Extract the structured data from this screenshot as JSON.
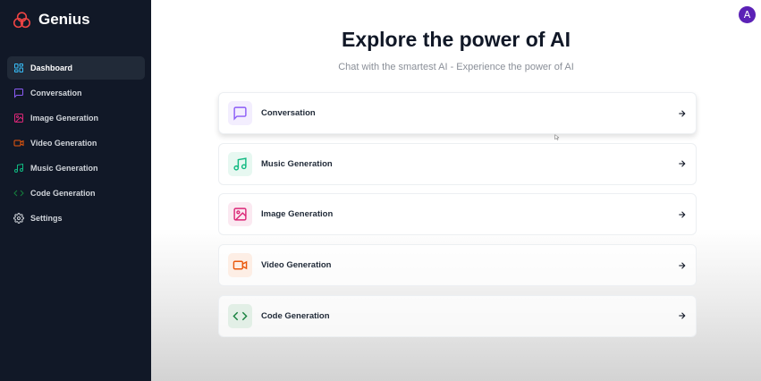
{
  "app": {
    "name": "Genius",
    "brand_color": "#ef4444"
  },
  "sidebar": {
    "items": [
      {
        "label": "Dashboard",
        "icon": "layout-dashboard-icon",
        "color": "#38bdf8",
        "active": true
      },
      {
        "label": "Conversation",
        "icon": "message-square-icon",
        "color": "#8b5cf6"
      },
      {
        "label": "Image Generation",
        "icon": "image-icon",
        "color": "#db2777"
      },
      {
        "label": "Video Generation",
        "icon": "video-icon",
        "color": "#ea580c"
      },
      {
        "label": "Music Generation",
        "icon": "music-icon",
        "color": "#10b981"
      },
      {
        "label": "Code Generation",
        "icon": "code-icon",
        "color": "#15803d"
      },
      {
        "label": "Settings",
        "icon": "settings-icon",
        "color": "#d1d5db"
      }
    ]
  },
  "header": {
    "avatar_initial": "A",
    "avatar_color": "#5b21b6"
  },
  "main": {
    "title": "Explore the power of AI",
    "subtitle": "Chat with the smartest AI - Experience the power of AI",
    "tools": [
      {
        "label": "Conversation",
        "icon": "message-square-icon",
        "color": "#8b5cf6",
        "bg": "#f3eefe"
      },
      {
        "label": "Music Generation",
        "icon": "music-icon",
        "color": "#10b981",
        "bg": "#e7f8f1"
      },
      {
        "label": "Image Generation",
        "icon": "image-icon",
        "color": "#db2777",
        "bg": "#fbe9f1"
      },
      {
        "label": "Video Generation",
        "icon": "video-icon",
        "color": "#ea580c",
        "bg": "#fdeee5"
      },
      {
        "label": "Code Generation",
        "icon": "code-icon",
        "color": "#15803d",
        "bg": "#e2efe6"
      }
    ]
  }
}
